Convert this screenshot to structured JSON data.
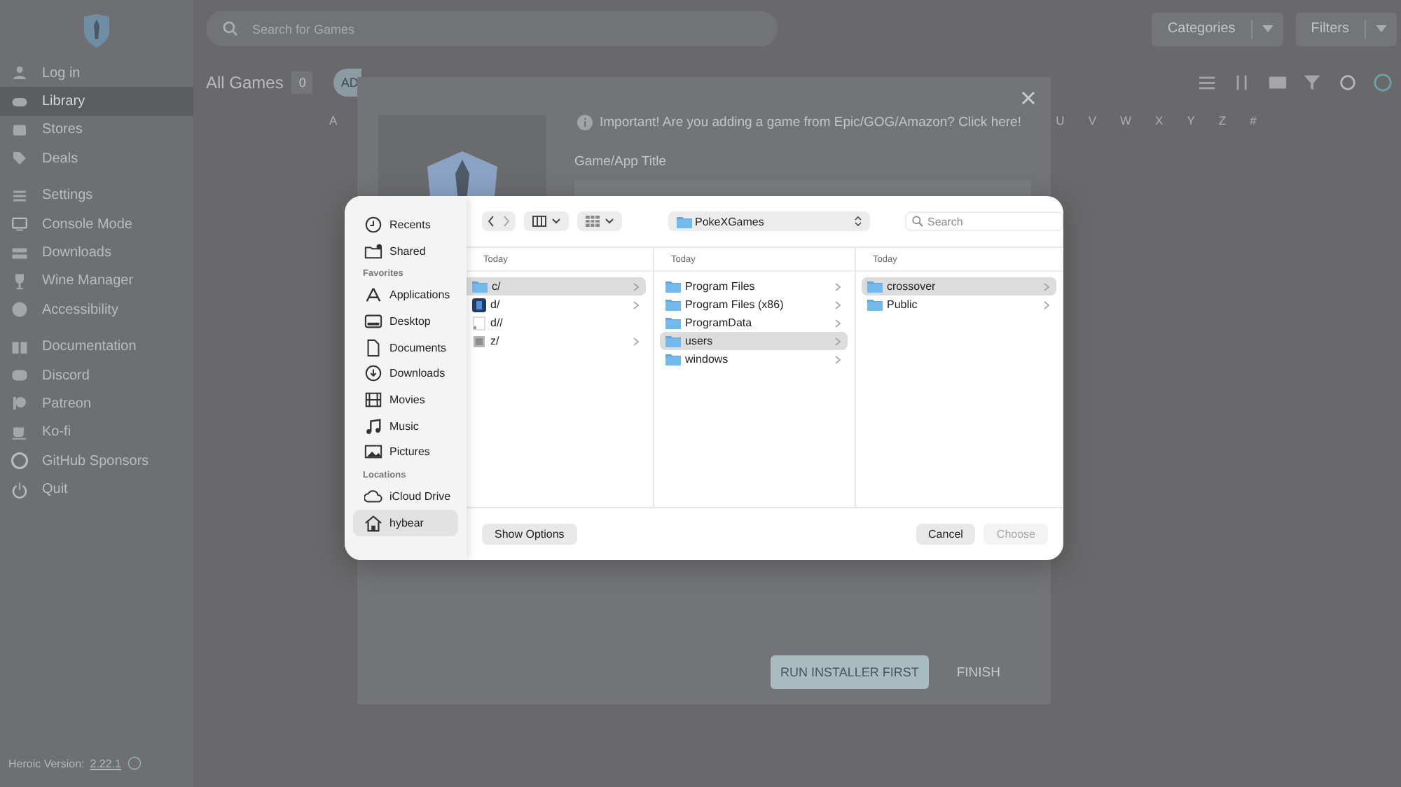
{
  "sidebar": {
    "groups": [
      [
        {
          "label": "Log in",
          "selected": false
        },
        {
          "label": "Library",
          "selected": true
        },
        {
          "label": "Stores",
          "selected": false
        },
        {
          "label": "Deals",
          "selected": false
        }
      ],
      [
        {
          "label": "Settings",
          "selected": false
        },
        {
          "label": "Console Mode",
          "selected": false
        },
        {
          "label": "Downloads",
          "selected": false
        },
        {
          "label": "Wine Manager",
          "selected": false
        },
        {
          "label": "Accessibility",
          "selected": false
        }
      ],
      [
        {
          "label": "Documentation",
          "selected": false
        },
        {
          "label": "Discord",
          "selected": false
        },
        {
          "label": "Patreon",
          "selected": false
        },
        {
          "label": "Ko-fi",
          "selected": false
        },
        {
          "label": "GitHub Sponsors",
          "selected": false
        },
        {
          "label": "Quit",
          "selected": false
        }
      ]
    ],
    "version_label": "Heroic Version:",
    "version": "2.22.1"
  },
  "header": {
    "search": {
      "placeholder": "Search for Games"
    },
    "categories": "Categories",
    "filters": "Filters"
  },
  "library": {
    "title": "All Games",
    "count": "0",
    "add_button": "AD",
    "letters": [
      "A",
      "U",
      "V",
      "W",
      "X",
      "Y",
      "Z",
      "#"
    ]
  },
  "modal": {
    "notice": "Important! Are you adding a game from Epic/GOG/Amazon? Click here!",
    "title_label": "Game/App Title",
    "buttons": [
      {
        "label": "RUN INSTALLER FIRST",
        "kind": "primary"
      },
      {
        "label": "FINISH",
        "kind": "text"
      }
    ]
  },
  "file_dialog": {
    "sidebar": [
      {
        "items": [
          {
            "label": "Recents",
            "selected": false
          },
          {
            "label": "Shared",
            "selected": false
          }
        ]
      },
      {
        "heading": "Favorites",
        "items": [
          {
            "label": "Applications",
            "selected": false
          },
          {
            "label": "Desktop",
            "selected": false
          },
          {
            "label": "Documents",
            "selected": false
          },
          {
            "label": "Downloads",
            "selected": false
          },
          {
            "label": "Movies",
            "selected": false
          },
          {
            "label": "Music",
            "selected": false
          },
          {
            "label": "Pictures",
            "selected": false
          }
        ]
      },
      {
        "heading": "Locations",
        "items": [
          {
            "label": "iCloud Drive",
            "selected": false
          },
          {
            "label": "hybear",
            "selected": true
          }
        ]
      }
    ],
    "location": "PokeXGames",
    "search": {
      "placeholder": "Search"
    },
    "columns": [
      {
        "header": "Today",
        "items": [
          {
            "name": "c/",
            "kind": "folder",
            "selected": true,
            "expandable": true
          },
          {
            "name": "d/",
            "kind": "disk",
            "selected": false,
            "expandable": true
          },
          {
            "name": "d//",
            "kind": "file",
            "selected": false,
            "expandable": false
          },
          {
            "name": "z/",
            "kind": "drive",
            "selected": false,
            "expandable": true
          }
        ]
      },
      {
        "header": "Today",
        "items": [
          {
            "name": "Program Files",
            "kind": "folder",
            "selected": false,
            "expandable": true
          },
          {
            "name": "Program Files (x86)",
            "kind": "folder",
            "selected": false,
            "expandable": true
          },
          {
            "name": "ProgramData",
            "kind": "folder",
            "selected": false,
            "expandable": true
          },
          {
            "name": "users",
            "kind": "folder",
            "selected": true,
            "expandable": true
          },
          {
            "name": "windows",
            "kind": "folder",
            "selected": false,
            "expandable": true
          }
        ]
      },
      {
        "header": "Today",
        "items": [
          {
            "name": "crossover",
            "kind": "folder",
            "selected": true,
            "expandable": true
          },
          {
            "name": "Public",
            "kind": "folder",
            "selected": false,
            "expandable": true
          }
        ]
      }
    ],
    "options_button": "Show Options",
    "cancel_button": "Cancel",
    "choose_button": {
      "label": "Choose",
      "disabled": true
    }
  }
}
